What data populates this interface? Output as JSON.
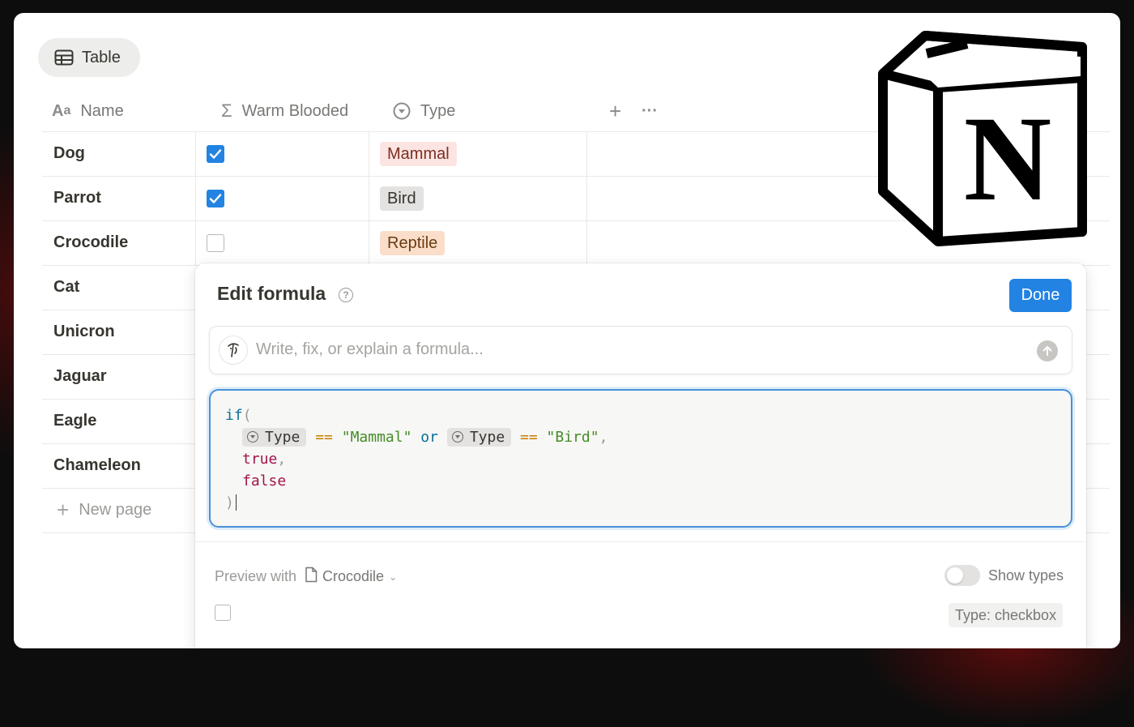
{
  "view": {
    "label": "Table",
    "icon": "table-icon"
  },
  "columns": [
    {
      "label": "Name",
      "icon": "text-aa-icon"
    },
    {
      "label": "Warm Blooded",
      "icon": "sigma-icon"
    },
    {
      "label": "Type",
      "icon": "select-icon"
    }
  ],
  "header_actions": {
    "add": "+",
    "more": "···"
  },
  "rows": [
    {
      "name": "Dog",
      "warm_blooded": true,
      "type": "Mammal"
    },
    {
      "name": "Parrot",
      "warm_blooded": true,
      "type": "Bird"
    },
    {
      "name": "Crocodile",
      "warm_blooded": false,
      "type": "Reptile"
    },
    {
      "name": "Cat"
    },
    {
      "name": "Unicron"
    },
    {
      "name": "Jaguar"
    },
    {
      "name": "Eagle"
    },
    {
      "name": "Chameleon"
    }
  ],
  "tag_colors": {
    "Mammal": {
      "bg": "#fbe4e1",
      "fg": "#7d2e22"
    },
    "Bird": {
      "bg": "#e3e2e0",
      "fg": "#37352f"
    },
    "Reptile": {
      "bg": "#fadec9",
      "fg": "#6b3b14"
    }
  },
  "new_page": {
    "label": "New page"
  },
  "formula_editor": {
    "title": "Edit formula",
    "done_label": "Done",
    "ai_placeholder": "Write, fix, or explain a formula...",
    "code": {
      "if_kw": "if",
      "open_paren": "(",
      "prop1": "Type",
      "eq1": "==",
      "str1": "\"Mammal\"",
      "or_kw": "or",
      "prop2": "Type",
      "eq2": "==",
      "str2": "\"Bird\"",
      "comma": ",",
      "true_kw": "true",
      "false_kw": "false",
      "close_paren": ")"
    },
    "preview_label": "Preview with",
    "preview_page": "Crocodile",
    "show_types_label": "Show types",
    "show_types_on": false,
    "result_type": "Type: checkbox",
    "result_value": false
  },
  "accent_color": "#2383e2"
}
